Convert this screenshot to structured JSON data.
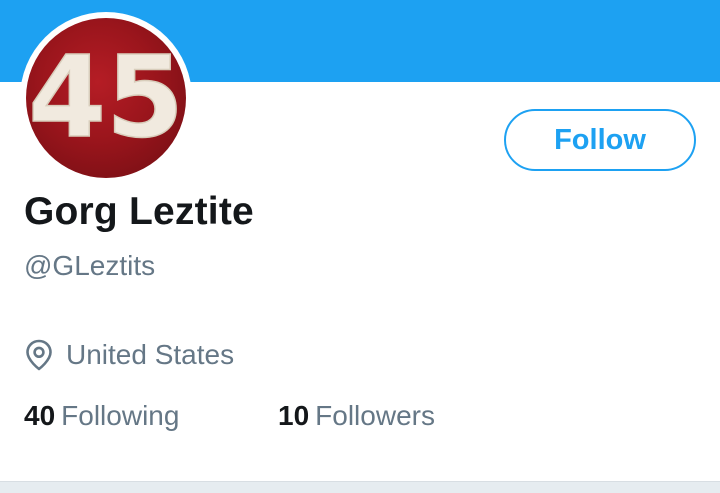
{
  "profile": {
    "avatar_text": "45",
    "display_name": "Gorg Leztite",
    "handle": "@GLeztits",
    "location": "United States",
    "follow_label": "Follow"
  },
  "stats": {
    "following_count": "40",
    "following_label": "Following",
    "followers_count": "10",
    "followers_label": "Followers"
  },
  "icons": {
    "location": "map-pin-icon"
  },
  "colors": {
    "accent": "#1da1f2",
    "text_primary": "#14171a",
    "text_secondary": "#657786",
    "avatar_bg": "#a3161e"
  }
}
